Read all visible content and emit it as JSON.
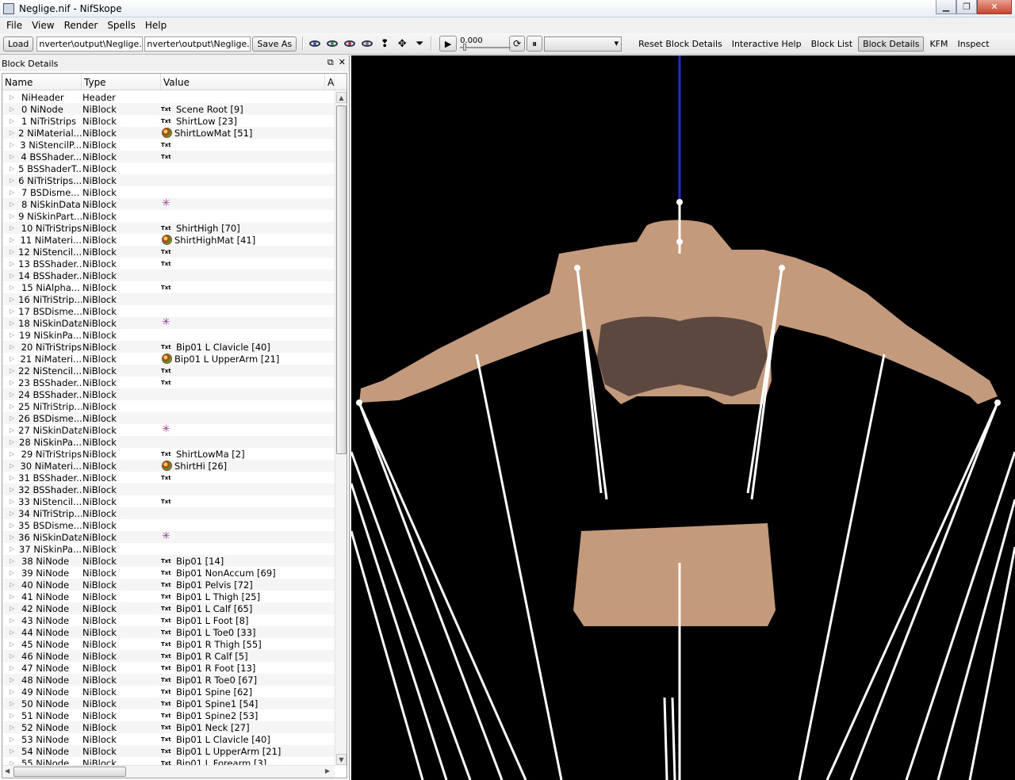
{
  "window": {
    "title": "Neglige.nif - NifSkope"
  },
  "menu": [
    "File",
    "View",
    "Render",
    "Spells",
    "Help"
  ],
  "toolbar": {
    "load_label": "Load",
    "load_path": "nverter\\output\\Neglige.nif",
    "save_path": "nverter\\output\\Neglige.nif",
    "save_as_label": "Save As",
    "anim_time": "0.000",
    "links": [
      "Reset Block Details",
      "Interactive Help",
      "Block List",
      "Block Details",
      "KFM",
      "Inspect"
    ],
    "active_link": "Block Details"
  },
  "dock": {
    "title": "Block Details",
    "columns": {
      "name": "Name",
      "type": "Type",
      "value": "Value",
      "a": "A"
    },
    "rows": [
      {
        "name": "NiHeader",
        "type": "Header",
        "icon": "",
        "value": ""
      },
      {
        "name": "0 NiNode",
        "type": "NiBlock",
        "icon": "txt",
        "value": "Scene Root [9]"
      },
      {
        "name": "1 NiTriStrips",
        "type": "NiBlock",
        "icon": "txt",
        "value": "ShirtLow [23]"
      },
      {
        "name": "2 NiMaterial...",
        "type": "NiBlock",
        "icon": "mat",
        "value": "ShirtLowMat [51]"
      },
      {
        "name": "3 NiStencilP...",
        "type": "NiBlock",
        "icon": "txt",
        "value": ""
      },
      {
        "name": "4 BSShader...",
        "type": "NiBlock",
        "icon": "txt",
        "value": ""
      },
      {
        "name": "5 BSShaderT...",
        "type": "NiBlock",
        "icon": "",
        "value": ""
      },
      {
        "name": "6 NiTriStrips...",
        "type": "NiBlock",
        "icon": "",
        "value": ""
      },
      {
        "name": "7 BSDisme...",
        "type": "NiBlock",
        "icon": "",
        "value": ""
      },
      {
        "name": "8 NiSkinData",
        "type": "NiBlock",
        "icon": "star",
        "value": ""
      },
      {
        "name": "9 NiSkinPart...",
        "type": "NiBlock",
        "icon": "",
        "value": ""
      },
      {
        "name": "10 NiTriStrips",
        "type": "NiBlock",
        "icon": "txt",
        "value": "ShirtHigh [70]"
      },
      {
        "name": "11 NiMateri...",
        "type": "NiBlock",
        "icon": "mat",
        "value": "ShirtHighMat [41]"
      },
      {
        "name": "12 NiStencil...",
        "type": "NiBlock",
        "icon": "txt",
        "value": ""
      },
      {
        "name": "13 BSShader...",
        "type": "NiBlock",
        "icon": "txt",
        "value": ""
      },
      {
        "name": "14 BSShader...",
        "type": "NiBlock",
        "icon": "",
        "value": ""
      },
      {
        "name": "15 NiAlpha...",
        "type": "NiBlock",
        "icon": "txt",
        "value": ""
      },
      {
        "name": "16 NiTriStrip...",
        "type": "NiBlock",
        "icon": "",
        "value": ""
      },
      {
        "name": "17 BSDisme...",
        "type": "NiBlock",
        "icon": "",
        "value": ""
      },
      {
        "name": "18 NiSkinData",
        "type": "NiBlock",
        "icon": "star",
        "value": ""
      },
      {
        "name": "19 NiSkinPa...",
        "type": "NiBlock",
        "icon": "",
        "value": ""
      },
      {
        "name": "20 NiTriStrips",
        "type": "NiBlock",
        "icon": "txt",
        "value": "Bip01 L Clavicle [40]"
      },
      {
        "name": "21 NiMateri...",
        "type": "NiBlock",
        "icon": "mat",
        "value": "Bip01 L UpperArm [21]"
      },
      {
        "name": "22 NiStencil...",
        "type": "NiBlock",
        "icon": "txt",
        "value": ""
      },
      {
        "name": "23 BSShader...",
        "type": "NiBlock",
        "icon": "txt",
        "value": ""
      },
      {
        "name": "24 BSShader...",
        "type": "NiBlock",
        "icon": "",
        "value": ""
      },
      {
        "name": "25 NiTriStrip...",
        "type": "NiBlock",
        "icon": "",
        "value": ""
      },
      {
        "name": "26 BSDisme...",
        "type": "NiBlock",
        "icon": "",
        "value": ""
      },
      {
        "name": "27 NiSkinData",
        "type": "NiBlock",
        "icon": "star",
        "value": ""
      },
      {
        "name": "28 NiSkinPa...",
        "type": "NiBlock",
        "icon": "",
        "value": ""
      },
      {
        "name": "29 NiTriStrips",
        "type": "NiBlock",
        "icon": "txt",
        "value": "ShirtLowMa [2]"
      },
      {
        "name": "30 NiMateri...",
        "type": "NiBlock",
        "icon": "mat",
        "value": "ShirtHi [26]"
      },
      {
        "name": "31 BSShader...",
        "type": "NiBlock",
        "icon": "txt",
        "value": ""
      },
      {
        "name": "32 BSShader...",
        "type": "NiBlock",
        "icon": "",
        "value": ""
      },
      {
        "name": "33 NiStencil...",
        "type": "NiBlock",
        "icon": "txt",
        "value": ""
      },
      {
        "name": "34 NiTriStrip...",
        "type": "NiBlock",
        "icon": "",
        "value": ""
      },
      {
        "name": "35 BSDisme...",
        "type": "NiBlock",
        "icon": "",
        "value": ""
      },
      {
        "name": "36 NiSkinData",
        "type": "NiBlock",
        "icon": "star",
        "value": ""
      },
      {
        "name": "37 NiSkinPa...",
        "type": "NiBlock",
        "icon": "",
        "value": ""
      },
      {
        "name": "38 NiNode",
        "type": "NiBlock",
        "icon": "txt",
        "value": "Bip01 [14]"
      },
      {
        "name": "39 NiNode",
        "type": "NiBlock",
        "icon": "txt",
        "value": "Bip01 NonAccum [69]"
      },
      {
        "name": "40 NiNode",
        "type": "NiBlock",
        "icon": "txt",
        "value": "Bip01 Pelvis [72]"
      },
      {
        "name": "41 NiNode",
        "type": "NiBlock",
        "icon": "txt",
        "value": "Bip01 L Thigh [25]"
      },
      {
        "name": "42 NiNode",
        "type": "NiBlock",
        "icon": "txt",
        "value": "Bip01 L Calf [65]"
      },
      {
        "name": "43 NiNode",
        "type": "NiBlock",
        "icon": "txt",
        "value": "Bip01 L Foot [8]"
      },
      {
        "name": "44 NiNode",
        "type": "NiBlock",
        "icon": "txt",
        "value": "Bip01 L Toe0 [33]"
      },
      {
        "name": "45 NiNode",
        "type": "NiBlock",
        "icon": "txt",
        "value": "Bip01 R Thigh [55]"
      },
      {
        "name": "46 NiNode",
        "type": "NiBlock",
        "icon": "txt",
        "value": "Bip01 R Calf [5]"
      },
      {
        "name": "47 NiNode",
        "type": "NiBlock",
        "icon": "txt",
        "value": "Bip01 R Foot [13]"
      },
      {
        "name": "48 NiNode",
        "type": "NiBlock",
        "icon": "txt",
        "value": "Bip01 R Toe0 [67]"
      },
      {
        "name": "49 NiNode",
        "type": "NiBlock",
        "icon": "txt",
        "value": "Bip01 Spine [62]"
      },
      {
        "name": "50 NiNode",
        "type": "NiBlock",
        "icon": "txt",
        "value": "Bip01 Spine1 [54]"
      },
      {
        "name": "51 NiNode",
        "type": "NiBlock",
        "icon": "txt",
        "value": "Bip01 Spine2 [53]"
      },
      {
        "name": "52 NiNode",
        "type": "NiBlock",
        "icon": "txt",
        "value": "Bip01 Neck [27]"
      },
      {
        "name": "53 NiNode",
        "type": "NiBlock",
        "icon": "txt",
        "value": "Bip01 L Clavicle [40]"
      },
      {
        "name": "54 NiNode",
        "type": "NiBlock",
        "icon": "txt",
        "value": "Bip01 L UpperArm [21]"
      },
      {
        "name": "55 NiNode",
        "type": "NiBlock",
        "icon": "txt",
        "value": "Bip01 L Forearm [3]"
      }
    ]
  },
  "icons": {
    "txt_label": "Txt"
  },
  "colors": {
    "viewport_bg": "#000000",
    "skin": "#c49a7c",
    "axis": "#1f2fd0"
  }
}
